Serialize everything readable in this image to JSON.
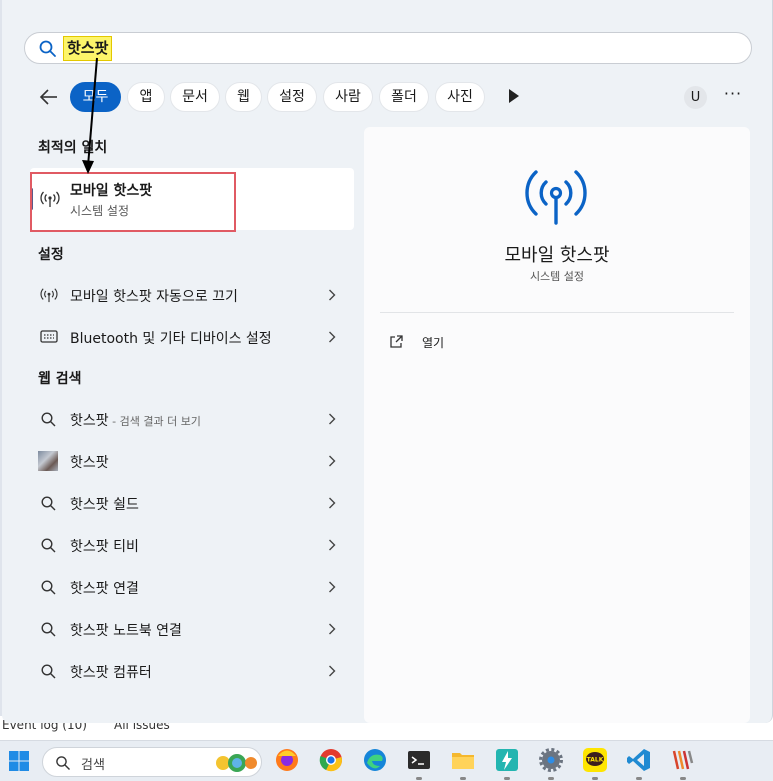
{
  "search": {
    "query": "핫스팟"
  },
  "filters": [
    {
      "label": "모두",
      "active": true
    },
    {
      "label": "앱"
    },
    {
      "label": "문서"
    },
    {
      "label": "웹"
    },
    {
      "label": "설정"
    },
    {
      "label": "사람"
    },
    {
      "label": "폴더"
    },
    {
      "label": "사진"
    }
  ],
  "user_initial": "U",
  "more_label": "···",
  "best_match": {
    "section_title": "최적의 일치",
    "name": "모바일 핫스팟",
    "subtitle": "시스템 설정",
    "icon": "hotspot-icon"
  },
  "settings": {
    "section_title": "설정",
    "items": [
      {
        "label": "모바일 핫스팟 자동으로 끄기",
        "icon": "hotspot-icon"
      },
      {
        "label": "Bluetooth 및 기타 디바이스 설정",
        "icon": "devices-icon"
      }
    ]
  },
  "web": {
    "section_title": "웹 검색",
    "first": {
      "label": "핫스팟",
      "suffix": " - 검색 결과 더 보기"
    },
    "items": [
      {
        "label": "핫스팟",
        "icon": "image-thumbnail"
      },
      {
        "label": "핫스팟 쉴드",
        "icon": "search-icon"
      },
      {
        "label": "핫스팟 티비",
        "icon": "search-icon"
      },
      {
        "label": "핫스팟 연결",
        "icon": "search-icon"
      },
      {
        "label": "핫스팟 노트북 연결",
        "icon": "search-icon"
      },
      {
        "label": "핫스팟 컴퓨터",
        "icon": "search-icon"
      }
    ]
  },
  "detail": {
    "title": "모바일 핫스팟",
    "subtitle": "시스템 설정",
    "open_label": "열기"
  },
  "background": {
    "event_log": "Event log (10)",
    "all_issues": "All issues"
  },
  "taskbar": {
    "search_placeholder": "검색",
    "apps": [
      "firefox-icon",
      "chrome-icon",
      "edge-icon",
      "terminal-icon",
      "file-explorer-icon",
      "flash-app-icon",
      "settings-icon",
      "kakaotalk-icon",
      "vscode-icon",
      "wavy-app-icon"
    ],
    "kakaotalk_label": "TALK"
  },
  "colors": {
    "accent": "#0b63c6",
    "highlight": "#fdf56a",
    "annotation": "#e05a63"
  }
}
